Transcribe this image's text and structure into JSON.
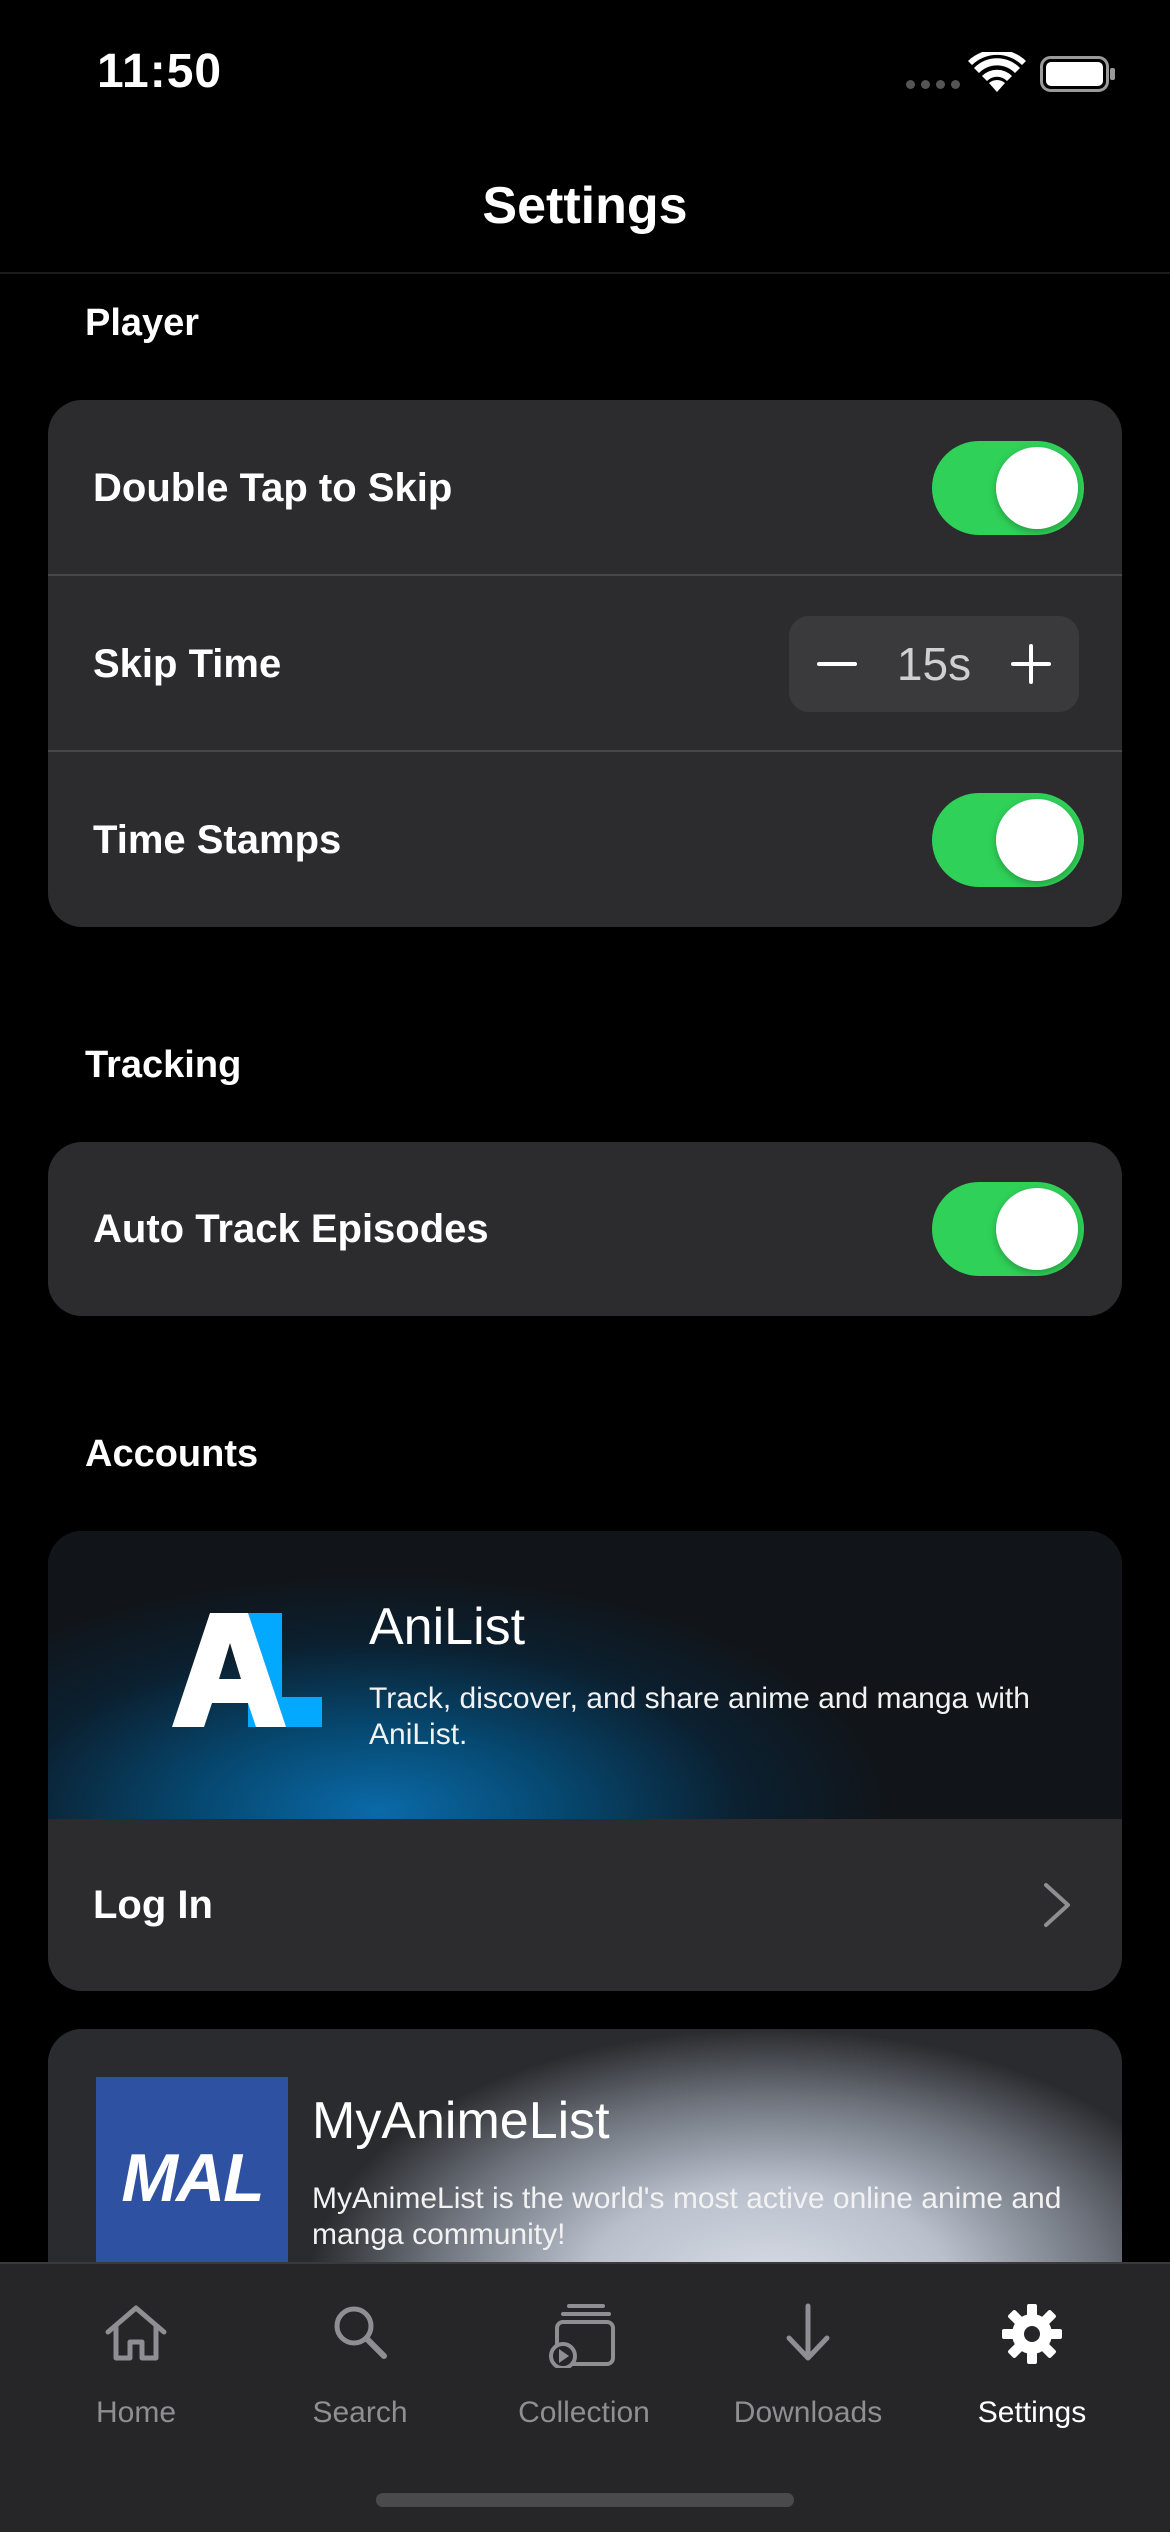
{
  "status_bar": {
    "time": "11:50"
  },
  "nav": {
    "title": "Settings"
  },
  "sections": {
    "player": {
      "header": "Player",
      "double_tap_label": "Double Tap to Skip",
      "double_tap_on": true,
      "skip_time_label": "Skip Time",
      "skip_time_value": "15s",
      "time_stamps_label": "Time Stamps",
      "time_stamps_on": true
    },
    "tracking": {
      "header": "Tracking",
      "auto_track_label": "Auto Track Episodes",
      "auto_track_on": true
    },
    "accounts": {
      "header": "Accounts",
      "anilist": {
        "name": "AniList",
        "description": "Track, discover, and share anime and manga with AniList.",
        "login_label": "Log In"
      },
      "myanimelist": {
        "name": "MyAnimeList",
        "logo_text": "MAL",
        "description": "MyAnimeList is the world's most active online anime and manga community!"
      }
    }
  },
  "tab_bar": {
    "tabs": [
      {
        "label": "Home",
        "icon": "house-icon"
      },
      {
        "label": "Search",
        "icon": "magnifier-icon"
      },
      {
        "label": "Collection",
        "icon": "stack-play-icon"
      },
      {
        "label": "Downloads",
        "icon": "arrow-down-icon"
      },
      {
        "label": "Settings",
        "icon": "gear-icon",
        "active": true
      }
    ]
  },
  "colors": {
    "toggle_on": "#30d158",
    "card_bg": "#2c2c2e",
    "mal_blue": "#2e51a2",
    "anilist_blue": "#02a9ff"
  }
}
